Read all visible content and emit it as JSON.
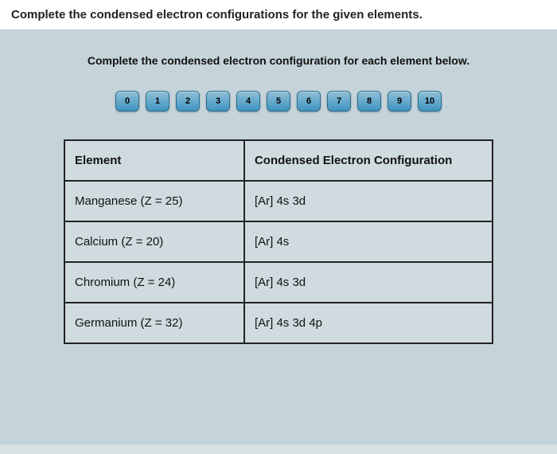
{
  "header": {
    "title": "Complete the condensed electron configurations for the given elements."
  },
  "subtitle": "Complete the condensed electron configuration for each element below.",
  "numbers": [
    "0",
    "1",
    "2",
    "3",
    "4",
    "5",
    "6",
    "7",
    "8",
    "9",
    "10"
  ],
  "table": {
    "headers": {
      "element": "Element",
      "config": "Condensed Electron Configuration"
    },
    "rows": [
      {
        "element": "Manganese (Z = 25)",
        "config": "[Ar] 4s   3d",
        "slots": 2
      },
      {
        "element": "Calcium (Z = 20)",
        "config": "[Ar] 4s",
        "slots": 1
      },
      {
        "element": "Chromium (Z = 24)",
        "config": "[Ar] 4s   3d",
        "slots": 2
      },
      {
        "element": "Germanium (Z = 32)",
        "config": "[Ar] 4s   3d   4p",
        "slots": 3
      }
    ]
  }
}
